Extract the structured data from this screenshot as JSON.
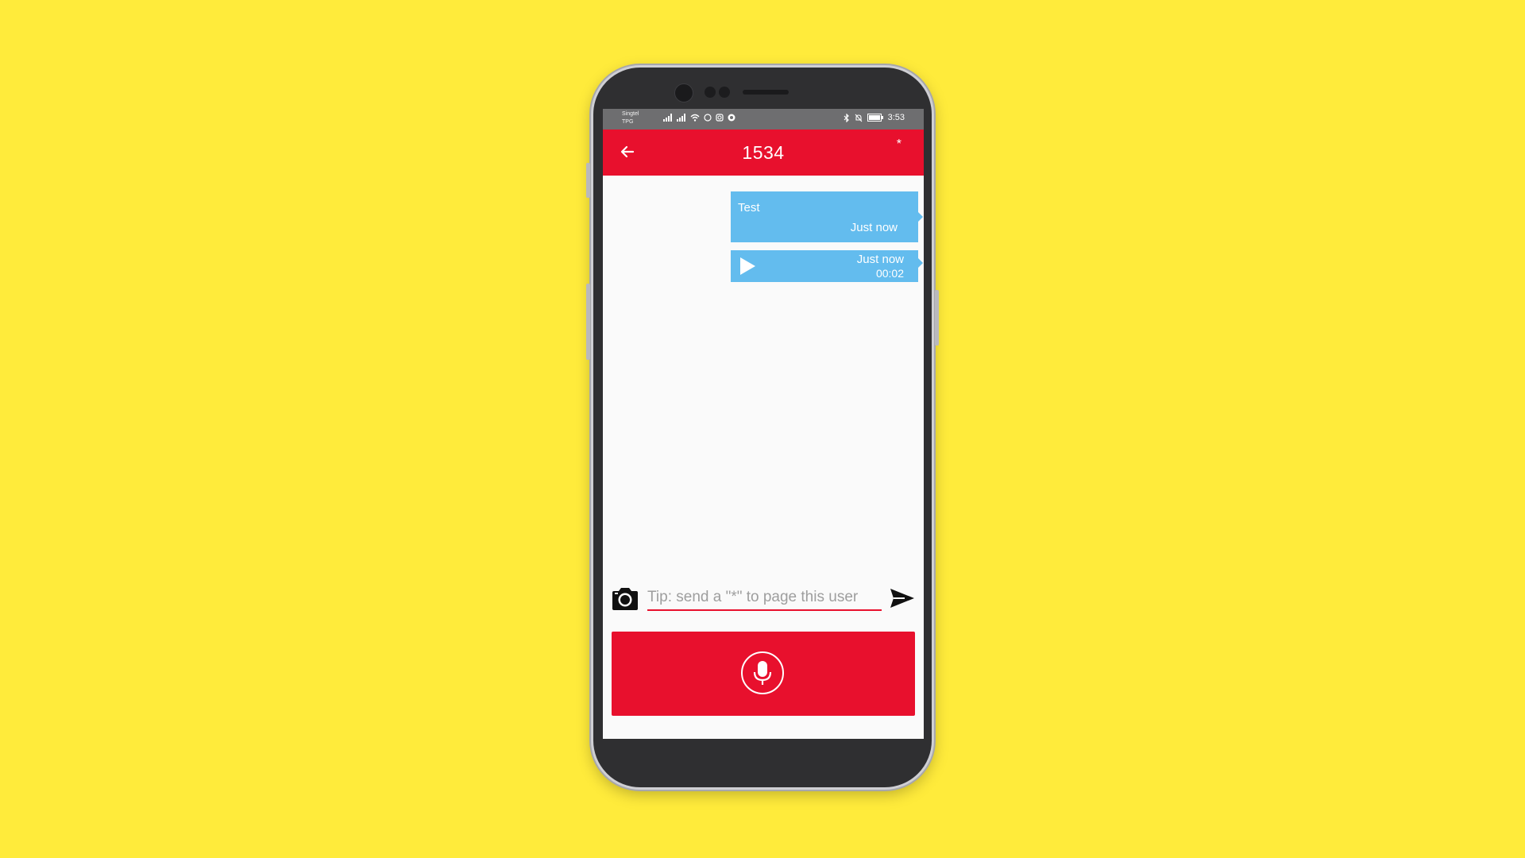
{
  "status_bar": {
    "carrier_line1": "Singtel",
    "carrier_line2": "TPG",
    "time": "3:53"
  },
  "app_bar": {
    "title": "1534",
    "page_button_label": "*"
  },
  "messages": [
    {
      "type": "text",
      "text": "Test",
      "time": "Just now"
    },
    {
      "type": "voice",
      "time": "Just now",
      "duration": "00:02"
    }
  ],
  "composer": {
    "placeholder": "Tip: send a \"*\" to page this user",
    "value": ""
  },
  "icons": {
    "back": "arrow-back-icon",
    "camera": "camera-icon",
    "send": "send-icon",
    "play": "play-icon",
    "mic": "microphone-icon"
  },
  "colors": {
    "background": "#FFEB3B",
    "accent": "#E8102D",
    "bubble": "#63BCEE",
    "status_bar": "#6E6E70"
  }
}
